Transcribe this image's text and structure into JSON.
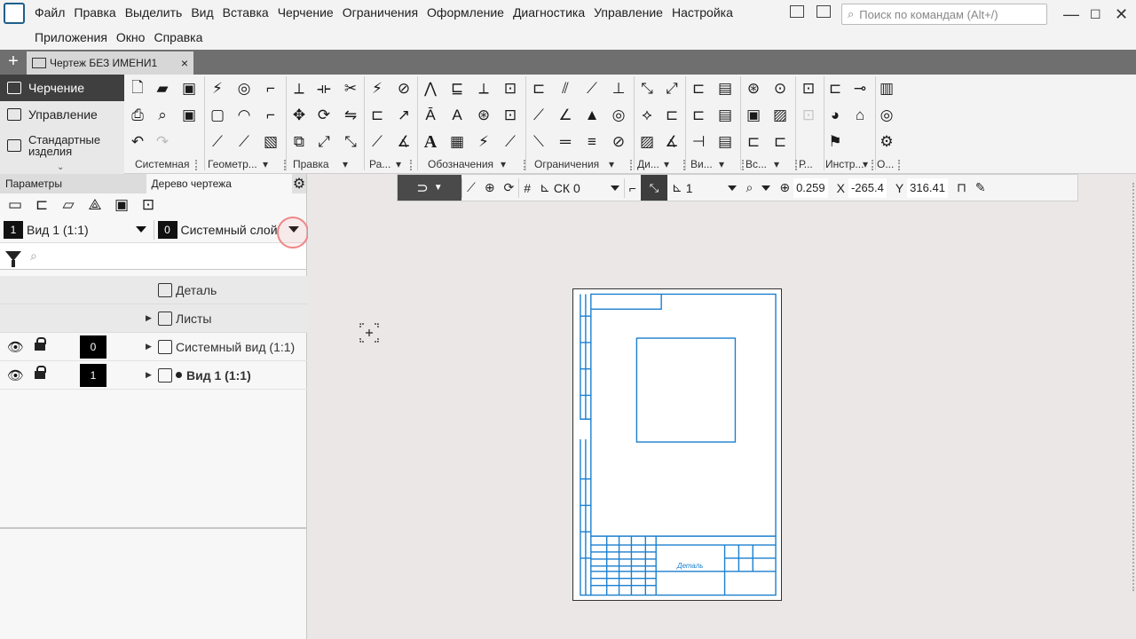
{
  "menubar": {
    "row1": [
      "Файл",
      "Правка",
      "Выделить",
      "Вид",
      "Вставка",
      "Черчение",
      "Ограничения",
      "Оформление",
      "Диагностика",
      "Управление",
      "Настройка"
    ],
    "row2": [
      "Приложения",
      "Окно",
      "Справка"
    ],
    "search_placeholder": "Поиск по командам (Alt+/)"
  },
  "tabbar": {
    "document_tab": "Чертеж БЕЗ ИМЕНИ1",
    "close_glyph": "×",
    "add_glyph": "+"
  },
  "ribbon": {
    "modes": [
      "Черчение",
      "Управление",
      "Стандартные изделия"
    ],
    "groups": [
      "Системная",
      "Геометр...",
      "Правка",
      "Ра...",
      "Обозначения",
      "Ограничения",
      "Ди...",
      "Ви...",
      "Вс...",
      "Р...",
      "Инстр...",
      "О..."
    ]
  },
  "left_panel": {
    "tabs": [
      "Параметры",
      "Дерево чертежа"
    ],
    "view_select": {
      "num": "1",
      "label": "Вид 1 (1:1)"
    },
    "layer_select": {
      "num": "0",
      "label": "Системный слой"
    },
    "tree": {
      "root": "Деталь",
      "sheets": "Листы",
      "rows": [
        {
          "layer": "0",
          "label": "Системный вид (1:1)"
        },
        {
          "layer": "1",
          "label": "Вид 1 (1:1)"
        }
      ]
    }
  },
  "snapbar": {
    "cs": "СК 0",
    "step": "1",
    "zoom": "0.259",
    "x_label": "X",
    "x_value": "-265.4",
    "y_label": "Y",
    "y_value": "316.41"
  },
  "sheet": {
    "part_name": "Деталь"
  },
  "colors": {
    "accent_dark": "#3f3f3f",
    "drawing_blue": "#1a7fcf",
    "highlight_ring": "#f08585"
  }
}
